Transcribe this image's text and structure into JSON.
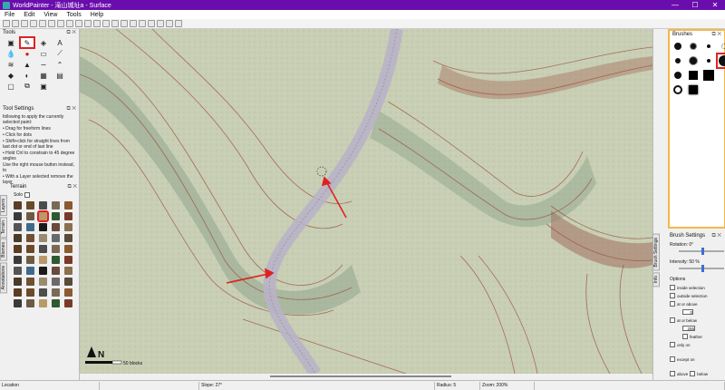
{
  "window": {
    "title": "WorldPainter - 滝山城址a - Surface",
    "controls": [
      "—",
      "☐",
      "✕"
    ]
  },
  "menu": [
    "File",
    "Edit",
    "View",
    "Tools",
    "Help"
  ],
  "tools_panel": {
    "title": "Tools"
  },
  "tool_settings": {
    "title": "Tool Settings",
    "lines": [
      "following to apply the currently selected paint:",
      "• Drag for freeform lines",
      "• Click for dots",
      "• Shift+click for straight lines from last dot or end of last line",
      "• Hold Ctrl to constrain to 45 degree angles",
      "Use the right mouse button instead, to",
      "• With a Layer selected remove the layer"
    ]
  },
  "terrain_panel": {
    "title": "Terrain",
    "solo_label": "Solo"
  },
  "side_tabs": [
    "Layers",
    "Terrain",
    "Biomes",
    "Annotations"
  ],
  "brushes_panel": {
    "title": "Brushes"
  },
  "brush_settings": {
    "title": "Brush Settings",
    "rotation_label": "Rotation: 0°",
    "intensity_label": "Intensity: 50 %",
    "rotation": 0,
    "intensity": 50,
    "options_title": "Options",
    "options": [
      "inside selection",
      "outside selection",
      "at or above",
      "at or below",
      "only on",
      "except on"
    ],
    "level_above": "0",
    "level_below": "255",
    "feather_label": "feather",
    "bottom": [
      "above",
      "below"
    ]
  },
  "right_tabs": [
    "Brush Settings",
    "Info"
  ],
  "map": {
    "scale_label": "50 blocks",
    "north_label": "N"
  },
  "status": {
    "location": "Location",
    "slope": "Slope: 27°",
    "radius": "Radius: 5",
    "zoom": "Zoom: 200%"
  },
  "colors": {
    "titlebar": "#6a0dad",
    "highlight": "#dd2222",
    "brush_panel_border": "#f5b74a",
    "road": "#b9b3c6",
    "contour": "#9c4a3a"
  }
}
